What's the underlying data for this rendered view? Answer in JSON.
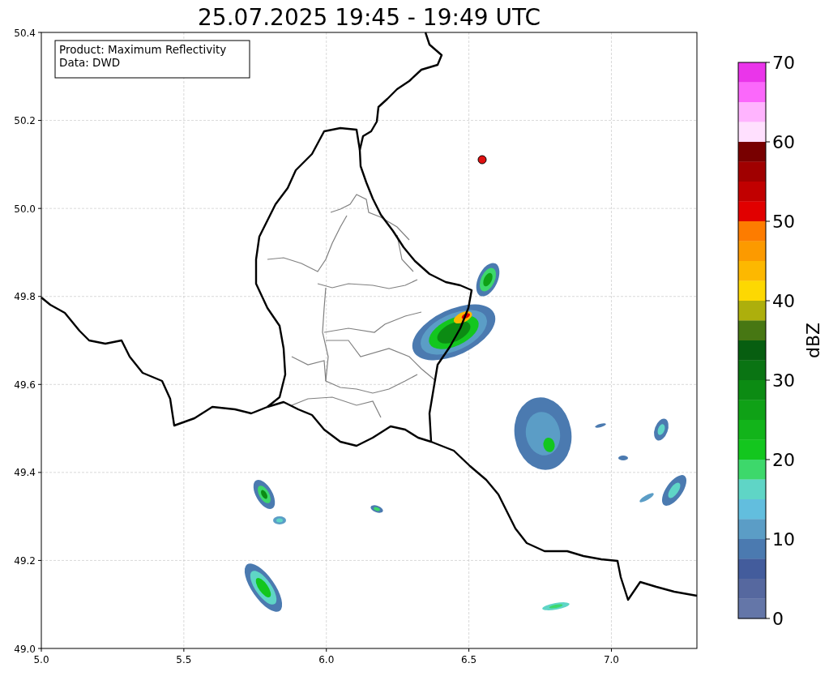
{
  "title": "25.07.2025 19:45 - 19:49 UTC",
  "info_box": {
    "lines": [
      "Product: Maximum Reflectivity",
      "Data: DWD"
    ]
  },
  "x_axis": {
    "ticks": [
      "5.0",
      "5.5",
      "6.0",
      "6.5",
      "7.0"
    ]
  },
  "y_axis": {
    "ticks": [
      "50.4",
      "50.2",
      "50.0",
      "49.8",
      "49.6",
      "49.4",
      "49.2",
      "49.0"
    ]
  },
  "colorbar": {
    "label": "dBZ",
    "ticks": [
      "70",
      "60",
      "50",
      "40",
      "30",
      "20",
      "10",
      "0"
    ],
    "segments": [
      {
        "color": "#ea35ea"
      },
      {
        "color": "#fb68fb"
      },
      {
        "color": "#ffb4fe"
      },
      {
        "color": "#ffe0fe"
      },
      {
        "color": "#780000"
      },
      {
        "color": "#a00000"
      },
      {
        "color": "#c10000"
      },
      {
        "color": "#e10000"
      },
      {
        "color": "#fd7c00"
      },
      {
        "color": "#fc9a00"
      },
      {
        "color": "#fdb800"
      },
      {
        "color": "#fdd802"
      },
      {
        "color": "#adaf0c"
      },
      {
        "color": "#477713"
      },
      {
        "color": "#075e10"
      },
      {
        "color": "#0a7413"
      },
      {
        "color": "#0c8b13"
      },
      {
        "color": "#0fa116"
      },
      {
        "color": "#12b41a"
      },
      {
        "color": "#13c61e"
      },
      {
        "color": "#3dd86b"
      },
      {
        "color": "#5fd5c6"
      },
      {
        "color": "#62bede"
      },
      {
        "color": "#5b9dc6"
      },
      {
        "color": "#4b7ab0"
      },
      {
        "color": "#435c9c"
      },
      {
        "color": "#56689f"
      },
      {
        "color": "#6476a8"
      }
    ]
  }
}
